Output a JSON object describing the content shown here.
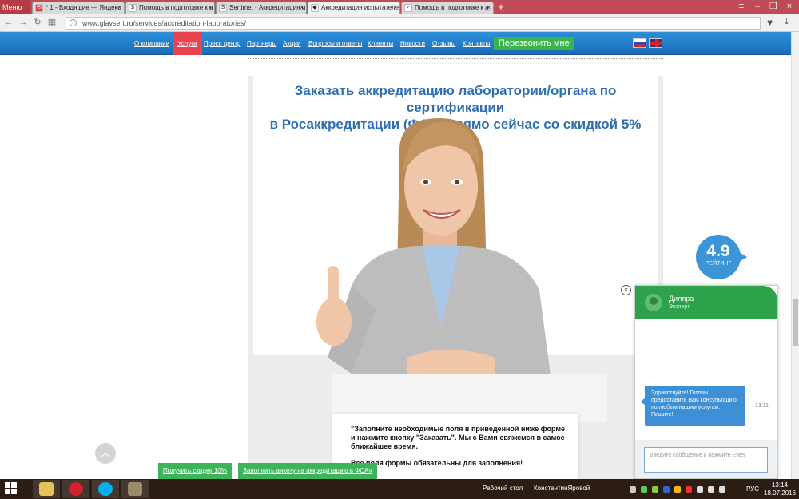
{
  "browser": {
    "menu_label": "Меню",
    "tabs": [
      {
        "label": "* 1 - Входящие — Яндекс",
        "favicon": "mail-icon",
        "active": false
      },
      {
        "label": "Помощь в подготовке к а",
        "favicon": "page-icon",
        "active": false
      },
      {
        "label": "Sertimet - Аккредитация и",
        "favicon": "sertimet-icon",
        "active": false
      },
      {
        "label": "Аккредитация испытателе",
        "favicon": "glavsert-icon",
        "active": true
      },
      {
        "label": "Помощь в подготовке к а",
        "favicon": "check-icon",
        "active": false
      }
    ],
    "new_tab": "+",
    "url": "www.glavsert.ru/services/accreditation-laboratories/"
  },
  "site_nav": {
    "links": [
      {
        "label": "О компании",
        "active": false
      },
      {
        "label": "Услуги",
        "active": true
      },
      {
        "label": "Пресс центр",
        "active": false
      },
      {
        "label": "Партнеры",
        "active": false
      },
      {
        "label": "Акции",
        "active": false
      },
      {
        "label": "Вопросы и ответы",
        "active": false
      },
      {
        "label": "Клиенты",
        "active": false
      },
      {
        "label": "Новости",
        "active": false
      },
      {
        "label": "Отзывы",
        "active": false
      },
      {
        "label": "Контакты",
        "active": false
      }
    ],
    "callback_button": "Перезвонить мне"
  },
  "main": {
    "headline_line1": "Заказать аккредитацию лаборатории/органа по сертификации",
    "headline_line2": "в Росаккредитации (ФСА) прямо сейчас со скидкой 5%",
    "form_intro": "\"Заполните необходимые поля в приведенной ниже форме и нажмите кнопку \"Заказать\". Мы с Вами свяжемся в самое ближайшее время.",
    "form_required": "Все поля формы обязательны для заполнения!"
  },
  "rating": {
    "value": "4.9",
    "label": "РЕЙТИНГ"
  },
  "chat": {
    "close": "×",
    "agent_name": "Диляра",
    "agent_role": "Эксперт",
    "message": "Здравствуйте! Готовы предоставить Вам консультацию по любым нашим услугам. Пишите!",
    "message_time": "13:11",
    "input_placeholder": "Введите сообщение и нажмите Enter"
  },
  "bottom_buttons": {
    "discount": "Получить скидку 10%",
    "survey": "Заполнить анкету на аккредитацию в ФСА»"
  },
  "taskbar": {
    "desktop_label": "Рабочий стол",
    "user_label": "КонстантинЯровой",
    "lang": "РУС",
    "time": "13:14",
    "date": "18.07.2016"
  },
  "colors": {
    "nav_blue": "#1f78c8",
    "nav_active": "#e8434f",
    "green": "#3cb45a",
    "headline_blue": "#2e6fb4",
    "chat_green": "#2ea14b"
  }
}
